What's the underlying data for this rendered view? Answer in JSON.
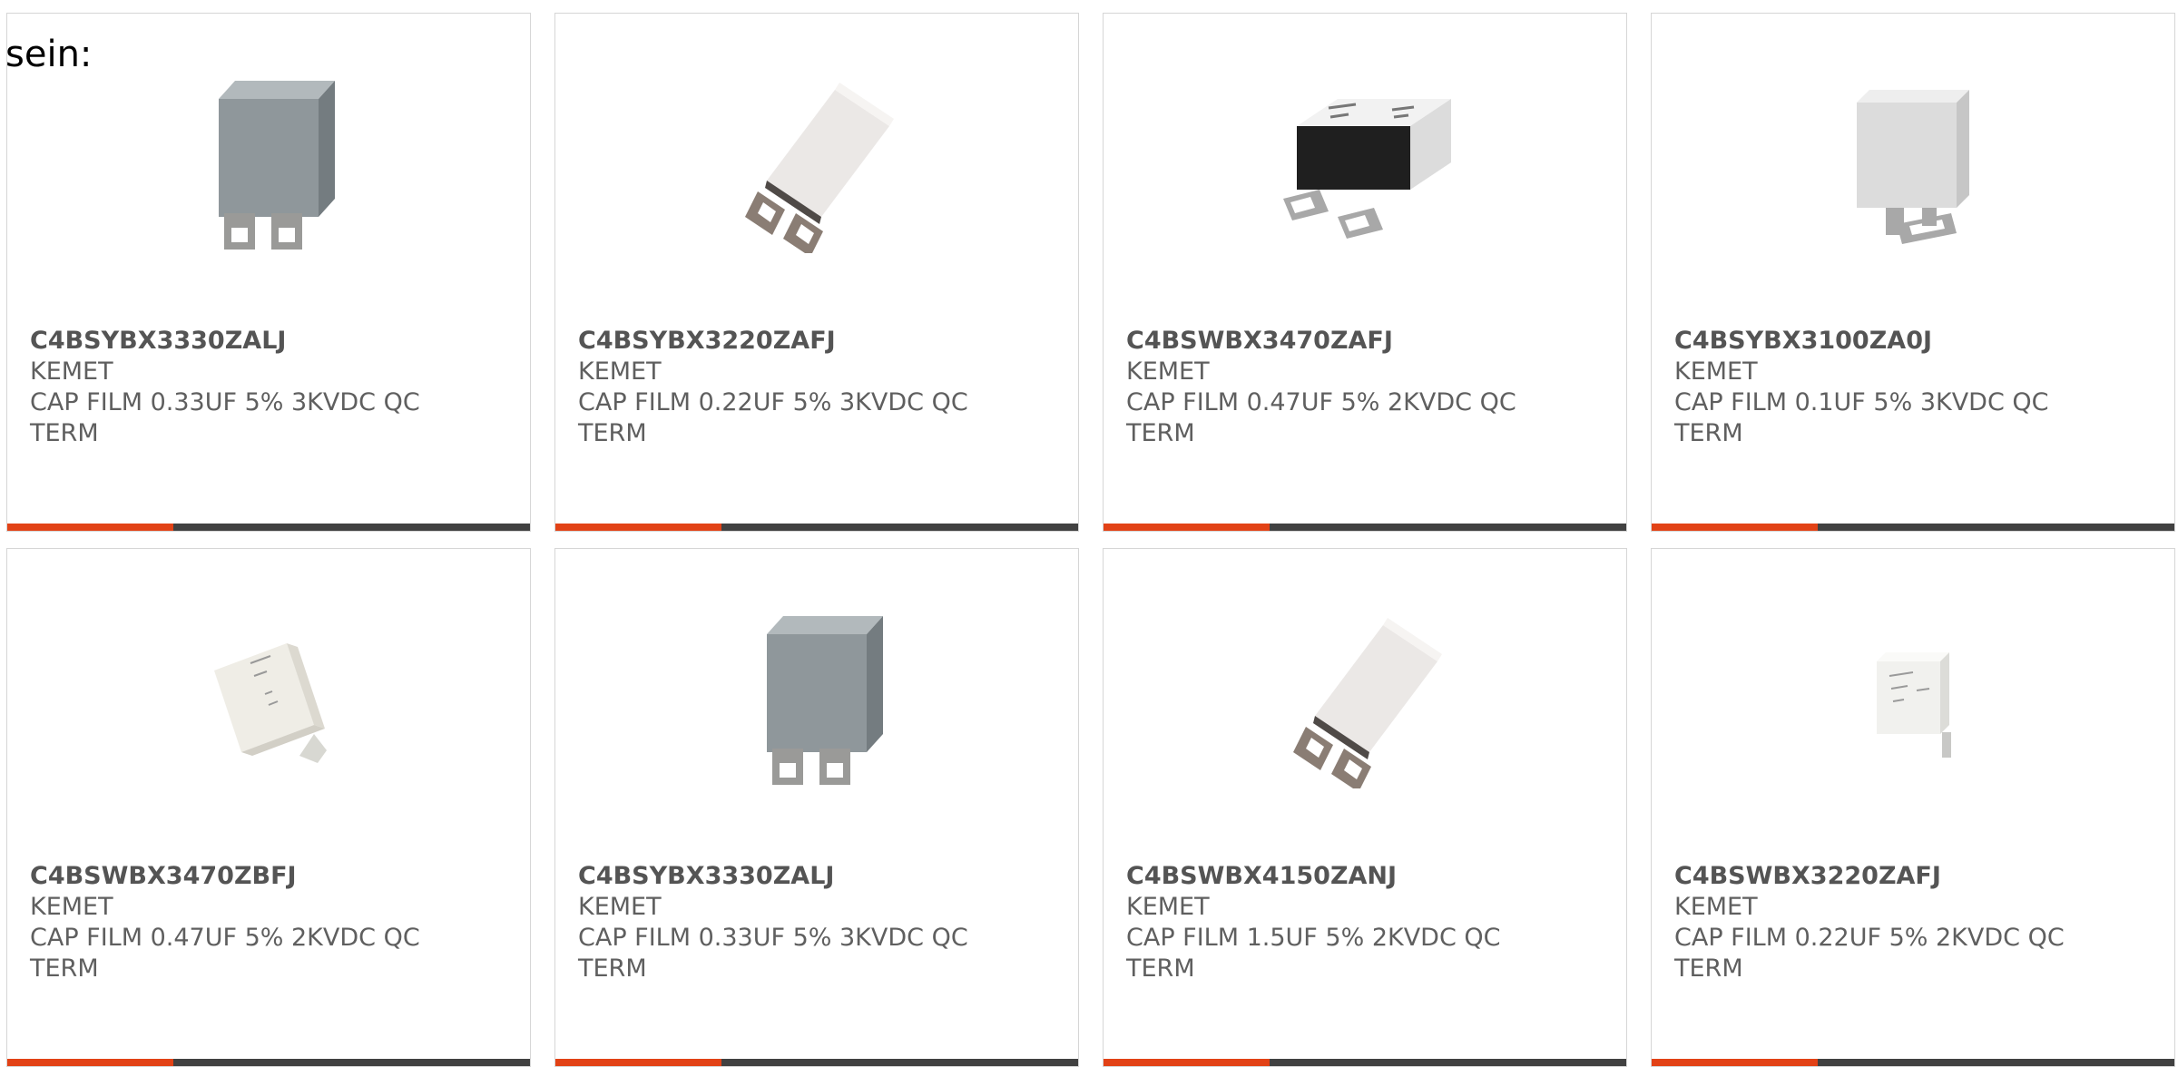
{
  "intro_text": "sein:",
  "colors": {
    "accent": "#e24216",
    "bar_rest": "#414141",
    "card_border": "#d6d6d6"
  },
  "products": [
    {
      "part_number": "C4BSYBX3330ZALJ",
      "manufacturer": "KEMET",
      "description": "CAP FILM 0.33UF 5% 3KVDC QC TERM",
      "image": "gray-box-film-capacitor"
    },
    {
      "part_number": "C4BSYBX3220ZAFJ",
      "manufacturer": "KEMET",
      "description": "CAP FILM 0.22UF 5% 3KVDC QC TERM",
      "image": "white-box-film-capacitor"
    },
    {
      "part_number": "C4BSWBX3470ZAFJ",
      "manufacturer": "KEMET",
      "description": "CAP FILM 0.47UF 5% 2KVDC QC TERM",
      "image": "white-black-box-film-capacitor"
    },
    {
      "part_number": "C4BSYBX3100ZA0J",
      "manufacturer": "KEMET",
      "description": "CAP FILM 0.1UF 5% 3KVDC QC TERM",
      "image": "light-gray-box-film-capacitor"
    },
    {
      "part_number": "C4BSWBX3470ZBFJ",
      "manufacturer": "KEMET",
      "description": "CAP FILM 0.47UF 5% 2KVDC QC TERM",
      "image": "small-white-film-capacitor"
    },
    {
      "part_number": "C4BSYBX3330ZALJ",
      "manufacturer": "KEMET",
      "description": "CAP FILM 0.33UF 5% 3KVDC QC TERM",
      "image": "gray-box-film-capacitor"
    },
    {
      "part_number": "C4BSWBX4150ZANJ",
      "manufacturer": "KEMET",
      "description": "CAP FILM 1.5UF 5% 2KVDC QC TERM",
      "image": "white-box-film-capacitor"
    },
    {
      "part_number": "C4BSWBX3220ZAFJ",
      "manufacturer": "KEMET",
      "description": "CAP FILM 0.22UF 5% 2KVDC QC TERM",
      "image": "small-white-film-capacitor"
    }
  ]
}
